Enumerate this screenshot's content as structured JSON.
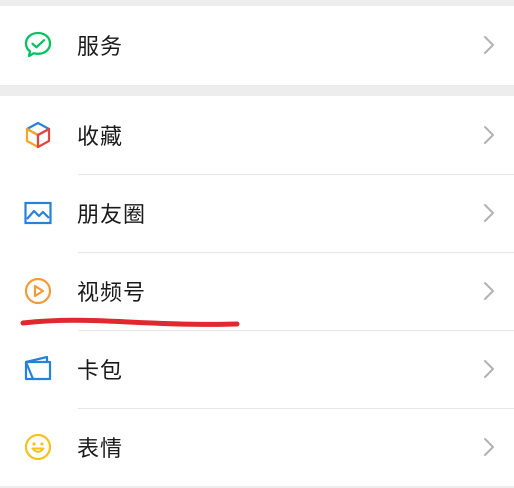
{
  "sections": [
    {
      "items": [
        {
          "label": "服务",
          "icon": "service-check-icon",
          "color": "#07c160"
        }
      ]
    },
    {
      "items": [
        {
          "label": "收藏",
          "icon": "favorites-cube-icon",
          "color": "#f5a623"
        },
        {
          "label": "朋友圈",
          "icon": "moments-picture-icon",
          "color": "#2782d7"
        },
        {
          "label": "视频号",
          "icon": "channels-play-icon",
          "color": "#f29b38"
        },
        {
          "label": "卡包",
          "icon": "card-wallet-icon",
          "color": "#2782d7"
        },
        {
          "label": "表情",
          "icon": "sticker-smile-icon",
          "color": "#f3c21b"
        }
      ]
    }
  ],
  "annotation": {
    "color": "#e0282e"
  }
}
